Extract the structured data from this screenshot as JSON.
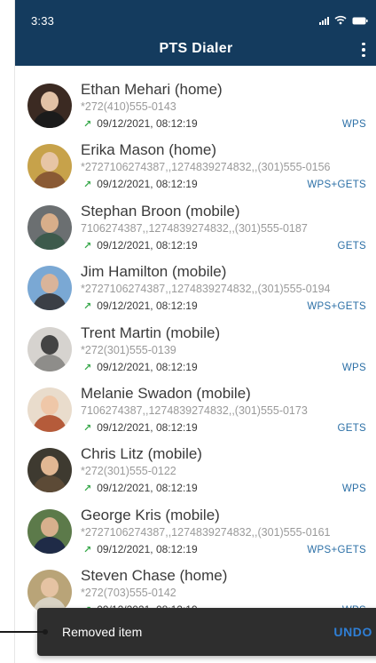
{
  "status_bar": {
    "time": "3:33"
  },
  "app_bar": {
    "title": "PTS Dialer"
  },
  "calls": [
    {
      "name": "Ethan Mehari (home)",
      "number": "*272(410)555-0143",
      "time": "09/12/2021, 08:12:19",
      "tag": "WPS",
      "colors": {
        "bg": "#3b2a22",
        "skin": "#e2c2a6",
        "clothes": "#1b1b1b"
      }
    },
    {
      "name": "Erika Mason (home)",
      "number": "*2727106274387,,1274839274832,,(301)555-0156",
      "time": "09/12/2021, 08:12:19",
      "tag": "WPS+GETS",
      "colors": {
        "bg": "#c7a24a",
        "skin": "#e7c5a5",
        "clothes": "#8a5a34"
      }
    },
    {
      "name": "Stephan Broon (mobile)",
      "number": "7106274387,,1274839274832,,(301)555-0187",
      "time": "09/12/2021, 08:12:19",
      "tag": "GETS",
      "colors": {
        "bg": "#6b6f71",
        "skin": "#d8ae8a",
        "clothes": "#3d5a4c"
      }
    },
    {
      "name": "Jim Hamilton (mobile)",
      "number": "*2727106274387,,1274839274832,,(301)555-0194",
      "time": "09/12/2021, 08:12:19",
      "tag": "WPS+GETS",
      "colors": {
        "bg": "#7aa8d4",
        "skin": "#d9b49a",
        "clothes": "#3b3f46"
      }
    },
    {
      "name": "Trent Martin (mobile)",
      "number": "*272(301)555-0139",
      "time": "09/12/2021, 08:12:19",
      "tag": "WPS",
      "colors": {
        "bg": "#d6d3cf",
        "skin": "#444444",
        "clothes": "#8e8d8a"
      }
    },
    {
      "name": "Melanie Swadon (mobile)",
      "number": "7106274387,,1274839274832,,(301)555-0173",
      "time": "09/12/2021, 08:12:19",
      "tag": "GETS",
      "colors": {
        "bg": "#e9dccc",
        "skin": "#efc7a8",
        "clothes": "#b55b3a"
      }
    },
    {
      "name": "Chris Litz (mobile)",
      "number": "*272(301)555-0122",
      "time": "09/12/2021, 08:12:19",
      "tag": "WPS",
      "colors": {
        "bg": "#3e3a30",
        "skin": "#e1b793",
        "clothes": "#5c4a36"
      }
    },
    {
      "name": "George Kris (mobile)",
      "number": "*2727106274387,,1274839274832,,(301)555-0161",
      "time": "09/12/2021, 08:12:19",
      "tag": "WPS+GETS",
      "colors": {
        "bg": "#5c7a4a",
        "skin": "#d7b08d",
        "clothes": "#1f2b47"
      }
    },
    {
      "name": "Steven Chase (home)",
      "number": "*272(703)555-0142",
      "time": "09/12/2021, 08:12:19",
      "tag": "WPS",
      "colors": {
        "bg": "#b9a478",
        "skin": "#e5c3a3",
        "clothes": "#d8d2c3"
      }
    }
  ],
  "snackbar": {
    "message": "Removed item",
    "action": "UNDO"
  }
}
